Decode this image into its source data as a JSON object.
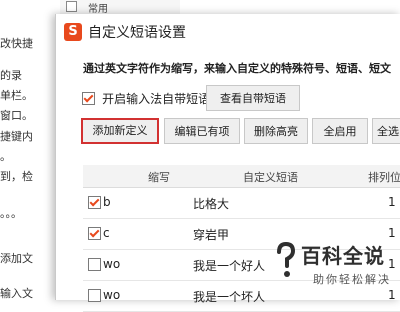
{
  "background": {
    "top_item_label": "常用",
    "lines": [
      "改快捷",
      "的录",
      "单栏。",
      "窗口。",
      "捷键内",
      "。",
      "到，检",
      "。。。",
      "添加文",
      "输入文"
    ]
  },
  "dialog": {
    "logo_text": "S",
    "title": "自定义短语设置",
    "description": "通过英文字符作为缩写，来输入自定义的特殊符号、短语、短文",
    "enable_checkbox_label": "开启输入法自带短语",
    "enable_checked": true,
    "view_builtin_button": "查看自带短语",
    "toolbar": {
      "add_new": "添加新定义",
      "edit_existing": "编辑已有项",
      "delete_highlight": "删除高亮",
      "enable_all": "全启用",
      "select_all": "全选"
    },
    "table": {
      "headers": [
        "缩写",
        "自定义短语",
        "排列位"
      ],
      "rows": [
        {
          "checked": true,
          "code": "b",
          "phrase": "比格大",
          "pos": "1"
        },
        {
          "checked": true,
          "code": "c",
          "phrase": "穿岩甲",
          "pos": "1"
        },
        {
          "checked": false,
          "code": "wo",
          "phrase": "我是一个好人",
          "pos": "1"
        },
        {
          "checked": false,
          "code": "wo",
          "phrase": "我是一个坏人",
          "pos": "1"
        }
      ]
    }
  },
  "watermark": {
    "title": "百科全说",
    "subtitle": "助你轻松解决"
  },
  "colors": {
    "accent": "#e8491d",
    "highlight_border": "#d23131"
  }
}
